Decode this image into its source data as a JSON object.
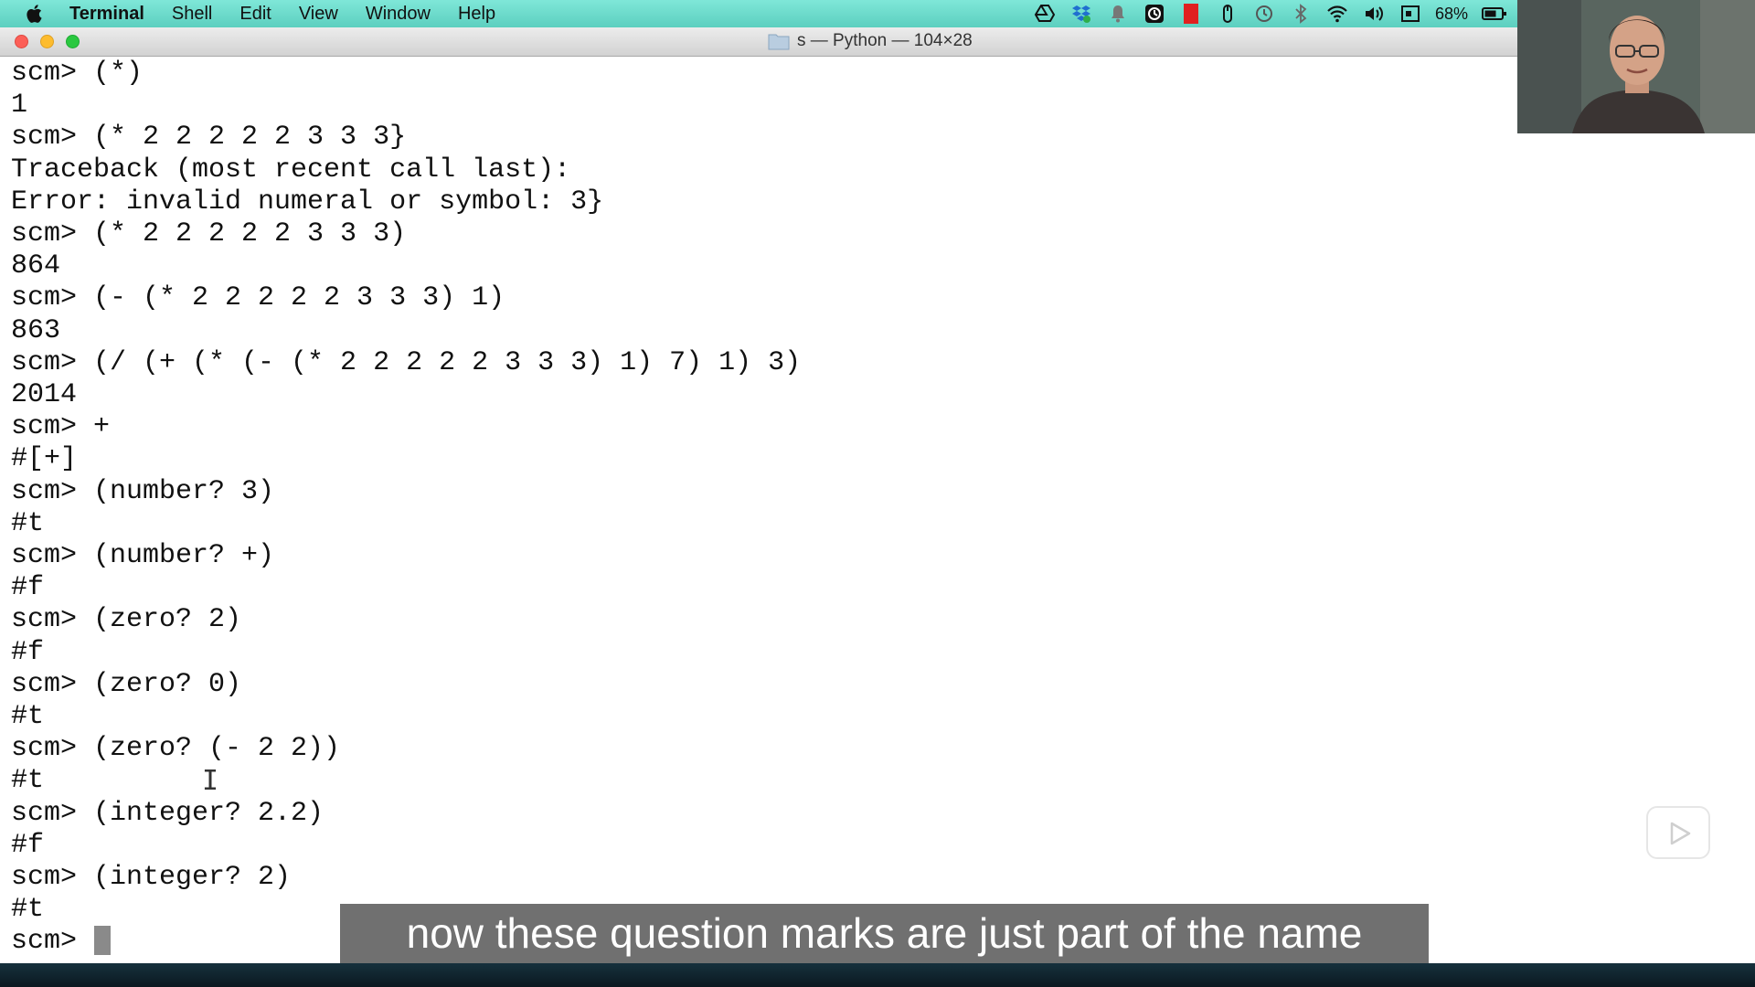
{
  "menubar": {
    "items": [
      {
        "label": "Terminal",
        "name": "menu-terminal"
      },
      {
        "label": "Shell",
        "name": "menu-shell"
      },
      {
        "label": "Edit",
        "name": "menu-edit"
      },
      {
        "label": "View",
        "name": "menu-view"
      },
      {
        "label": "Window",
        "name": "menu-window"
      },
      {
        "label": "Help",
        "name": "menu-help"
      }
    ],
    "status_icons": [
      "google-drive-icon",
      "dropbox-icon",
      "notification-bell-icon",
      "clock-app-icon",
      "red-app-icon",
      "mouse-icon",
      "time-machine-icon",
      "bluetooth-icon",
      "wifi-icon",
      "volume-icon",
      "display-icon"
    ],
    "battery": "68%"
  },
  "window": {
    "title": "s — Python — 104×28"
  },
  "terminal": {
    "lines": [
      "scm> (*)",
      "1",
      "scm> (* 2 2 2 2 2 3 3 3}",
      "Traceback (most recent call last):",
      "Error: invalid numeral or symbol: 3}",
      "scm> (* 2 2 2 2 2 3 3 3)",
      "864",
      "scm> (- (* 2 2 2 2 2 3 3 3) 1)",
      "863",
      "scm> (/ (+ (* (- (* 2 2 2 2 2 3 3 3) 1) 7) 1) 3)",
      "2014",
      "scm> +",
      "#[+]",
      "scm> (number? 3)",
      "#t",
      "scm> (number? +)",
      "#f",
      "scm> (zero? 2)",
      "#f",
      "scm> (zero? 0)",
      "#t",
      "scm> (zero? (- 2 2))",
      "#t",
      "scm> (integer? 2.2)",
      "#f",
      "scm> (integer? 2)",
      "#t",
      "scm> "
    ]
  },
  "subtitle": "now these question marks are just part of the name",
  "colors": {
    "menubar": "#6fdccd",
    "terminal_bg": "#ffffff",
    "terminal_text": "#111111",
    "subtitle_bg": "#5c5c5c"
  }
}
